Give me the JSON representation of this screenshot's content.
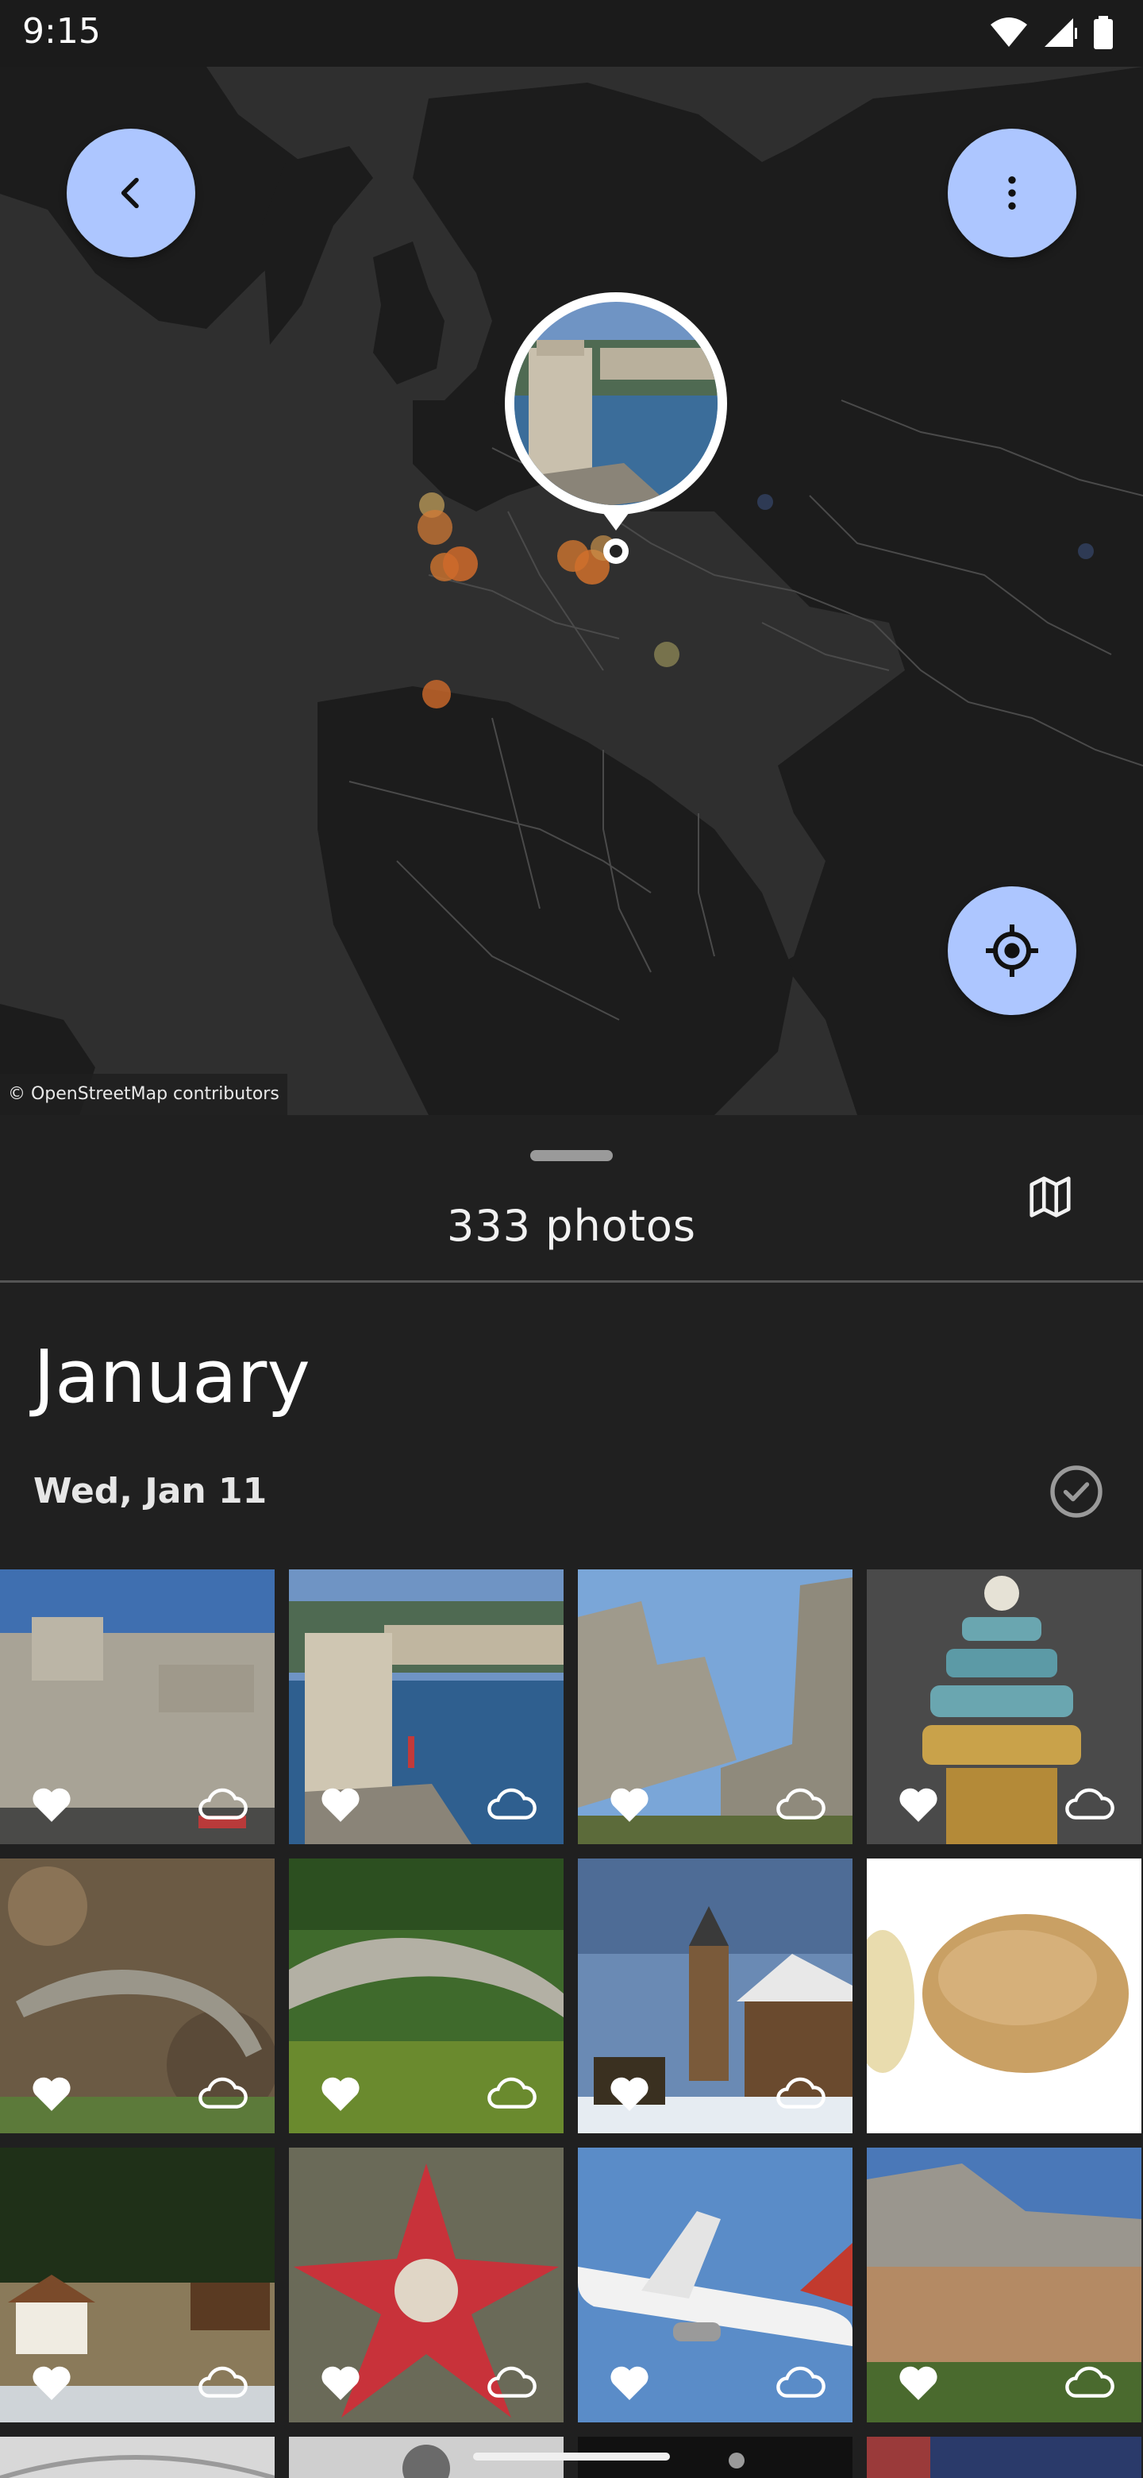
{
  "status_bar": {
    "time": "9:15"
  },
  "map": {
    "attribution": "© OpenStreetMap contributors",
    "back_icon": "chevron-left-icon",
    "menu_icon": "more-vert-icon",
    "locate_icon": "my-location-icon",
    "accent_color": "#adc6ff"
  },
  "sheet": {
    "photo_count": "333 photos",
    "map_toggle_icon": "map-icon"
  },
  "gallery": {
    "month": "January",
    "day_label": "Wed, Jan 11",
    "select_icon": "check-circle-icon",
    "favorite_icon": "heart-icon",
    "cloud_icon": "cloud-icon"
  }
}
